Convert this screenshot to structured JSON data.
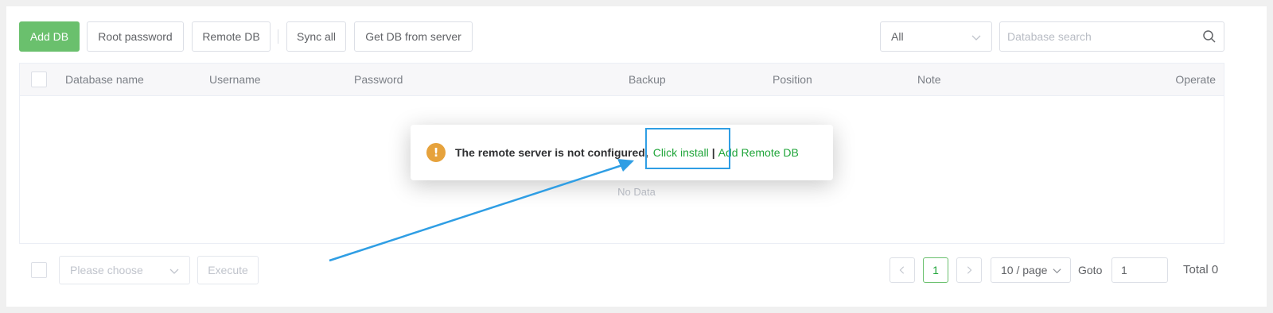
{
  "toolbar": {
    "add_db": "Add DB",
    "root_password": "Root password",
    "remote_db": "Remote DB",
    "sync_all": "Sync all",
    "get_db_from_server": "Get DB from server",
    "filter_value": "All",
    "search_placeholder": "Database search"
  },
  "table": {
    "columns": [
      "Database name",
      "Username",
      "Password",
      "Backup",
      "Position",
      "Note",
      "Operate"
    ],
    "empty_text": "No Data"
  },
  "popup": {
    "message": "The remote server is not configured,",
    "install_link": "Click install",
    "separator": "|",
    "add_remote_link": "Add Remote DB"
  },
  "footer": {
    "batch_placeholder": "Please choose",
    "execute": "Execute",
    "current_page": "1",
    "page_size": "10 / page",
    "goto_label": "Goto",
    "goto_value": "1",
    "total": "Total 0"
  },
  "colors": {
    "primary": "#6ac06d",
    "link": "#20a53a",
    "warning": "#e6a23c",
    "annotation": "#2f9ee4"
  }
}
